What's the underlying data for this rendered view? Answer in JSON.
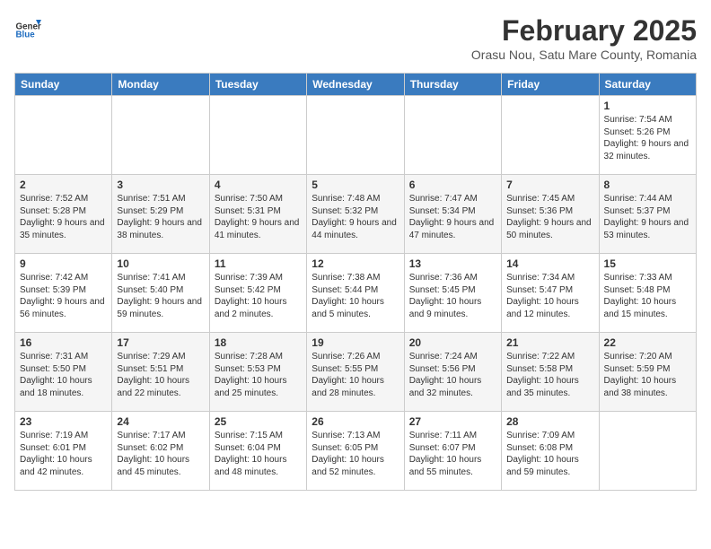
{
  "header": {
    "logo_general": "General",
    "logo_blue": "Blue",
    "month_title": "February 2025",
    "location": "Orasu Nou, Satu Mare County, Romania"
  },
  "columns": [
    "Sunday",
    "Monday",
    "Tuesday",
    "Wednesday",
    "Thursday",
    "Friday",
    "Saturday"
  ],
  "weeks": [
    [
      {
        "day": "",
        "info": ""
      },
      {
        "day": "",
        "info": ""
      },
      {
        "day": "",
        "info": ""
      },
      {
        "day": "",
        "info": ""
      },
      {
        "day": "",
        "info": ""
      },
      {
        "day": "",
        "info": ""
      },
      {
        "day": "1",
        "info": "Sunrise: 7:54 AM\nSunset: 5:26 PM\nDaylight: 9 hours and 32 minutes."
      }
    ],
    [
      {
        "day": "2",
        "info": "Sunrise: 7:52 AM\nSunset: 5:28 PM\nDaylight: 9 hours and 35 minutes."
      },
      {
        "day": "3",
        "info": "Sunrise: 7:51 AM\nSunset: 5:29 PM\nDaylight: 9 hours and 38 minutes."
      },
      {
        "day": "4",
        "info": "Sunrise: 7:50 AM\nSunset: 5:31 PM\nDaylight: 9 hours and 41 minutes."
      },
      {
        "day": "5",
        "info": "Sunrise: 7:48 AM\nSunset: 5:32 PM\nDaylight: 9 hours and 44 minutes."
      },
      {
        "day": "6",
        "info": "Sunrise: 7:47 AM\nSunset: 5:34 PM\nDaylight: 9 hours and 47 minutes."
      },
      {
        "day": "7",
        "info": "Sunrise: 7:45 AM\nSunset: 5:36 PM\nDaylight: 9 hours and 50 minutes."
      },
      {
        "day": "8",
        "info": "Sunrise: 7:44 AM\nSunset: 5:37 PM\nDaylight: 9 hours and 53 minutes."
      }
    ],
    [
      {
        "day": "9",
        "info": "Sunrise: 7:42 AM\nSunset: 5:39 PM\nDaylight: 9 hours and 56 minutes."
      },
      {
        "day": "10",
        "info": "Sunrise: 7:41 AM\nSunset: 5:40 PM\nDaylight: 9 hours and 59 minutes."
      },
      {
        "day": "11",
        "info": "Sunrise: 7:39 AM\nSunset: 5:42 PM\nDaylight: 10 hours and 2 minutes."
      },
      {
        "day": "12",
        "info": "Sunrise: 7:38 AM\nSunset: 5:44 PM\nDaylight: 10 hours and 5 minutes."
      },
      {
        "day": "13",
        "info": "Sunrise: 7:36 AM\nSunset: 5:45 PM\nDaylight: 10 hours and 9 minutes."
      },
      {
        "day": "14",
        "info": "Sunrise: 7:34 AM\nSunset: 5:47 PM\nDaylight: 10 hours and 12 minutes."
      },
      {
        "day": "15",
        "info": "Sunrise: 7:33 AM\nSunset: 5:48 PM\nDaylight: 10 hours and 15 minutes."
      }
    ],
    [
      {
        "day": "16",
        "info": "Sunrise: 7:31 AM\nSunset: 5:50 PM\nDaylight: 10 hours and 18 minutes."
      },
      {
        "day": "17",
        "info": "Sunrise: 7:29 AM\nSunset: 5:51 PM\nDaylight: 10 hours and 22 minutes."
      },
      {
        "day": "18",
        "info": "Sunrise: 7:28 AM\nSunset: 5:53 PM\nDaylight: 10 hours and 25 minutes."
      },
      {
        "day": "19",
        "info": "Sunrise: 7:26 AM\nSunset: 5:55 PM\nDaylight: 10 hours and 28 minutes."
      },
      {
        "day": "20",
        "info": "Sunrise: 7:24 AM\nSunset: 5:56 PM\nDaylight: 10 hours and 32 minutes."
      },
      {
        "day": "21",
        "info": "Sunrise: 7:22 AM\nSunset: 5:58 PM\nDaylight: 10 hours and 35 minutes."
      },
      {
        "day": "22",
        "info": "Sunrise: 7:20 AM\nSunset: 5:59 PM\nDaylight: 10 hours and 38 minutes."
      }
    ],
    [
      {
        "day": "23",
        "info": "Sunrise: 7:19 AM\nSunset: 6:01 PM\nDaylight: 10 hours and 42 minutes."
      },
      {
        "day": "24",
        "info": "Sunrise: 7:17 AM\nSunset: 6:02 PM\nDaylight: 10 hours and 45 minutes."
      },
      {
        "day": "25",
        "info": "Sunrise: 7:15 AM\nSunset: 6:04 PM\nDaylight: 10 hours and 48 minutes."
      },
      {
        "day": "26",
        "info": "Sunrise: 7:13 AM\nSunset: 6:05 PM\nDaylight: 10 hours and 52 minutes."
      },
      {
        "day": "27",
        "info": "Sunrise: 7:11 AM\nSunset: 6:07 PM\nDaylight: 10 hours and 55 minutes."
      },
      {
        "day": "28",
        "info": "Sunrise: 7:09 AM\nSunset: 6:08 PM\nDaylight: 10 hours and 59 minutes."
      },
      {
        "day": "",
        "info": ""
      }
    ]
  ]
}
